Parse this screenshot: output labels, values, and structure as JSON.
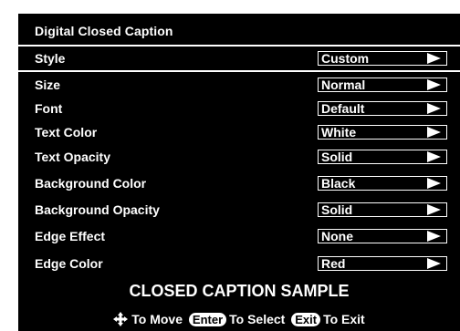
{
  "menu": {
    "title": "Digital Closed Caption",
    "items": [
      {
        "label": "Style",
        "value": "Custom"
      },
      {
        "label": "Size",
        "value": "Normal"
      },
      {
        "label": "Font",
        "value": "Default"
      },
      {
        "label": "Text Color",
        "value": "White"
      },
      {
        "label": "Text Opacity",
        "value": "Solid"
      },
      {
        "label": "Background Color",
        "value": "Black"
      },
      {
        "label": "Background Opacity",
        "value": "Solid"
      },
      {
        "label": "Edge Effect",
        "value": "None"
      },
      {
        "label": "Edge Color",
        "value": "Red"
      }
    ],
    "sample_text": "CLOSED CAPTION SAMPLE"
  },
  "footer": {
    "move_text": "To Move",
    "enter_key": "Enter",
    "select_text": "To Select",
    "exit_key": "Exit",
    "exit_text": "To Exit"
  },
  "icons": {
    "move": "four-way-arrow-icon",
    "option_arrow": "right-triangle-arrow-icon"
  },
  "colors": {
    "panel_bg": "#000000",
    "text": "#ffffff",
    "page_bg": "#ffffff"
  }
}
